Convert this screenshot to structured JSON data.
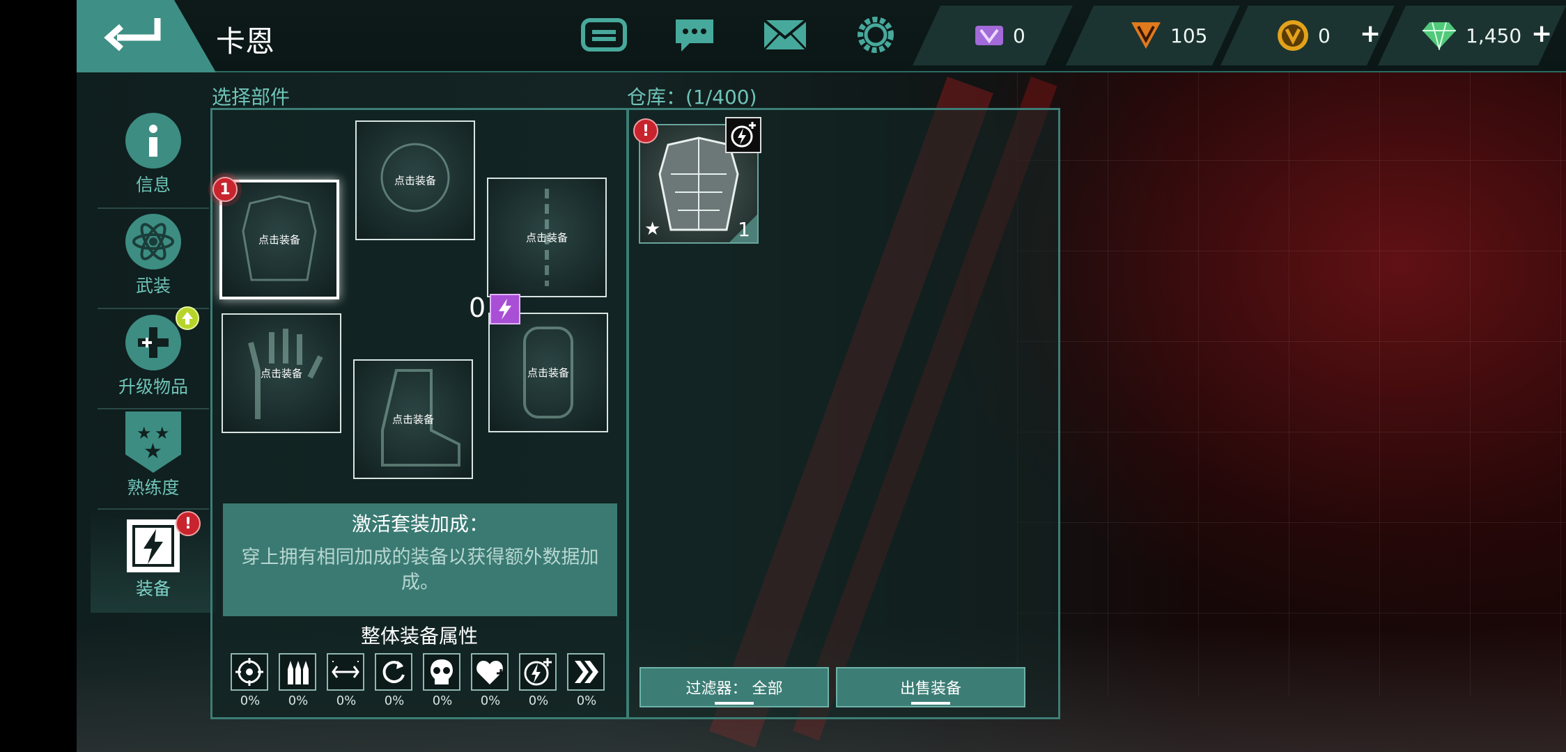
{
  "header": {
    "character_name": "卡恩",
    "icons": [
      "gameloft-icon",
      "chat-icon",
      "mail-icon",
      "settings-gear-icon"
    ]
  },
  "currencies": [
    {
      "name": "vip-ticket",
      "value": "0",
      "color": "#a36ad9",
      "has_plus": false
    },
    {
      "name": "v-token-orange",
      "value": "105",
      "color": "#e07a1e",
      "has_plus": false
    },
    {
      "name": "v-coin-gold",
      "value": "0",
      "color": "#e3a21a",
      "has_plus": true
    },
    {
      "name": "gems",
      "value": "1,450",
      "color": "#52c87a",
      "has_plus": true
    }
  ],
  "nav": {
    "items": [
      {
        "label": "信息",
        "icon": "info-icon"
      },
      {
        "label": "武装",
        "icon": "atom-icon"
      },
      {
        "label": "升级物品",
        "icon": "gamepad-upgrade-icon"
      },
      {
        "label": "熟练度",
        "icon": "stars-shield-icon"
      },
      {
        "label": "装备",
        "icon": "gear-lightning-icon"
      }
    ],
    "badge_text": "!"
  },
  "parts": {
    "title": "选择部件",
    "slot_label": "点击装备",
    "slots": [
      "chest",
      "helmet",
      "back",
      "gloves",
      "boots",
      "knee-pads"
    ],
    "chest_badge": "1",
    "energy_count": "0",
    "set_bonus_title": "激活套装加成：",
    "set_bonus_desc": "穿上拥有相同加成的装备以获得额外数据加成。",
    "attr_title": "整体装备属性",
    "attrs": [
      {
        "icon": "accuracy-crosshair-icon",
        "value": "0%"
      },
      {
        "icon": "ammo-bullets-icon",
        "value": "0%"
      },
      {
        "icon": "range-arrows-icon",
        "value": "0%"
      },
      {
        "icon": "reload-cycle-icon",
        "value": "0%"
      },
      {
        "icon": "damage-skull-icon",
        "value": "0%"
      },
      {
        "icon": "health-heart-plus-icon",
        "value": "0%"
      },
      {
        "icon": "energy-bolt-plus-icon",
        "value": "0%"
      },
      {
        "icon": "speed-chevrons-icon",
        "value": "0%"
      }
    ]
  },
  "warehouse": {
    "title": "仓库：(1/400)",
    "item": {
      "alert": "!",
      "star": "★",
      "quantity": "1"
    },
    "filter_button": "过滤器： 全部",
    "sell_button": "出售装备"
  }
}
